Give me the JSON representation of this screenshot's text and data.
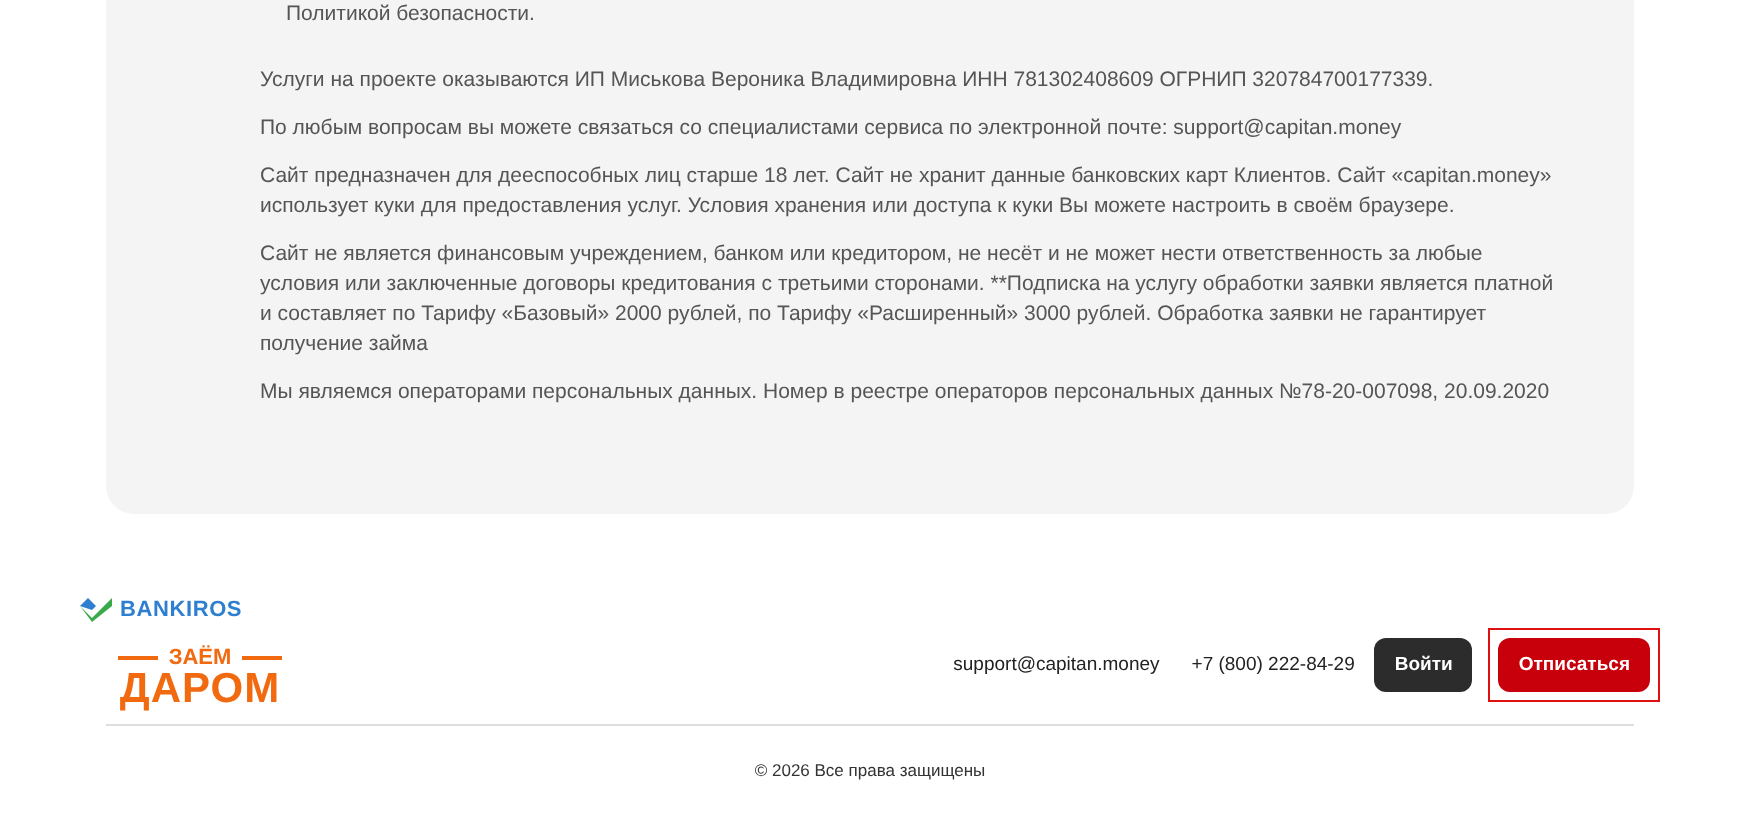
{
  "info_card": {
    "list_item": "Политикой безопасности.",
    "paragraphs": [
      "Услуги на проекте оказываются ИП Миськова Вероника Владимировна ИНН 781302408609 ОГРНИП 320784700177339.",
      "По любым вопросам вы можете связаться со специалистами сервиса по электронной почте: support@capitan.money",
      "Сайт предназначен для дееспособных лиц старше 18 лет. Сайт не хранит данные банковских карт Клиентов. Сайт «capitan.money» использует куки для предоставления услуг. Условия хранения или доступа к куки Вы можете настроить в своём браузере.",
      "Сайт не является финансовым учреждением, банком или кредитором, не несёт и не может нести ответственность за любые условия или заключенные договоры кредитования с третьими сторонами. **Подписка на услугу обработки заявки является платной и составляет по Тарифу «Базовый» 2000 рублей, по Тарифу «Расширенный» 3000 рублей. Обработка заявки не гарантирует получение займа",
      "Мы являемся операторами персональных данных. Номер в реестре операторов персональных данных №78-20-007098, 20.09.2020"
    ]
  },
  "footer": {
    "partner_logo": "BANKIROS",
    "brand_logo_top": "ЗАЁМ",
    "brand_logo_bottom": "ДАРОМ",
    "email": "support@capitan.money",
    "phone": "+7 (800) 222-84-29",
    "buttons": [
      {
        "label": "Войти",
        "kind": "dark",
        "highlighted": false
      },
      {
        "label": "Отписаться",
        "kind": "red",
        "highlighted": true
      }
    ],
    "copyright": "© 2026 Все права защищены"
  }
}
